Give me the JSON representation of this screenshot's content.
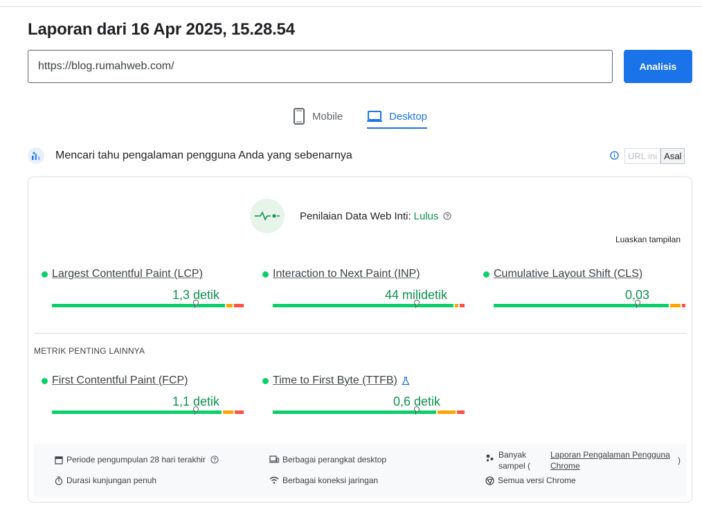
{
  "report": {
    "title": "Laporan dari 16 Apr 2025, 15.28.54"
  },
  "search": {
    "url": "https://blog.rumahweb.com/",
    "button_label": "Analisis"
  },
  "tabs": [
    {
      "label": "Mobile",
      "active": false,
      "icon": "smartphone-icon"
    },
    {
      "label": "Desktop",
      "active": true,
      "icon": "laptop-icon"
    }
  ],
  "field_data": {
    "title": "Mencari tahu pengalaman pengguna Anda yang sebenarnya",
    "toggle": {
      "url_only": "URL ini",
      "origin": "Asal",
      "selected": "Asal"
    }
  },
  "cwv": {
    "label": "Penilaian Data Web Inti:",
    "status": "Lulus",
    "expand_label": "Luaskan tampilan"
  },
  "core_metrics": [
    {
      "name": "Largest Contentful Paint (LCP)",
      "value": "1,3 detik",
      "status": "good",
      "distribution": {
        "good": 0.91,
        "needs_improvement": 0.04,
        "poor": 0.04
      },
      "marker": 0.745
    },
    {
      "name": "Interaction to Next Paint (INP)",
      "value": "44 milidetik",
      "status": "good",
      "distribution": {
        "good": 0.95,
        "needs_improvement": 0.025,
        "poor": 0.025
      },
      "marker": 0.745
    },
    {
      "name": "Cumulative Layout Shift (CLS)",
      "value": "0,03",
      "status": "good",
      "distribution": {
        "good": 0.92,
        "needs_improvement": 0.06,
        "poor": 0.02
      },
      "marker": 0.745
    }
  ],
  "other_heading": "METRIK PENTING LAINNYA",
  "other_metrics": [
    {
      "name": "First Contentful Paint (FCP)",
      "value": "1,1 detik",
      "status": "good",
      "distribution": {
        "good": 0.89,
        "needs_improvement": 0.06,
        "poor": 0.05
      },
      "marker": 0.745
    },
    {
      "name": "Time to First Byte (TTFB)",
      "value": "0,6 detik",
      "status": "good",
      "experimental": true,
      "distribution": {
        "good": 0.86,
        "needs_improvement": 0.1,
        "poor": 0.03
      },
      "marker": 0.745
    }
  ],
  "footer": {
    "period": "Periode pengumpulan 28 hari terakhir",
    "duration": "Durasi kunjungan penuh",
    "devices": "Berbagai perangkat desktop",
    "connections": "Berbagai koneksi jaringan",
    "samples_prefix": "Banyak sampel (",
    "samples_link": "Laporan Pengalaman Pengguna Chrome",
    "samples_suffix": ")",
    "chrome_versions": "Semua versi Chrome"
  },
  "colors": {
    "accent": "#1a73e8",
    "good": "#0cce6b",
    "good_text": "#0d904f",
    "needs_improvement": "#ffa400",
    "poor": "#ff4e42"
  }
}
